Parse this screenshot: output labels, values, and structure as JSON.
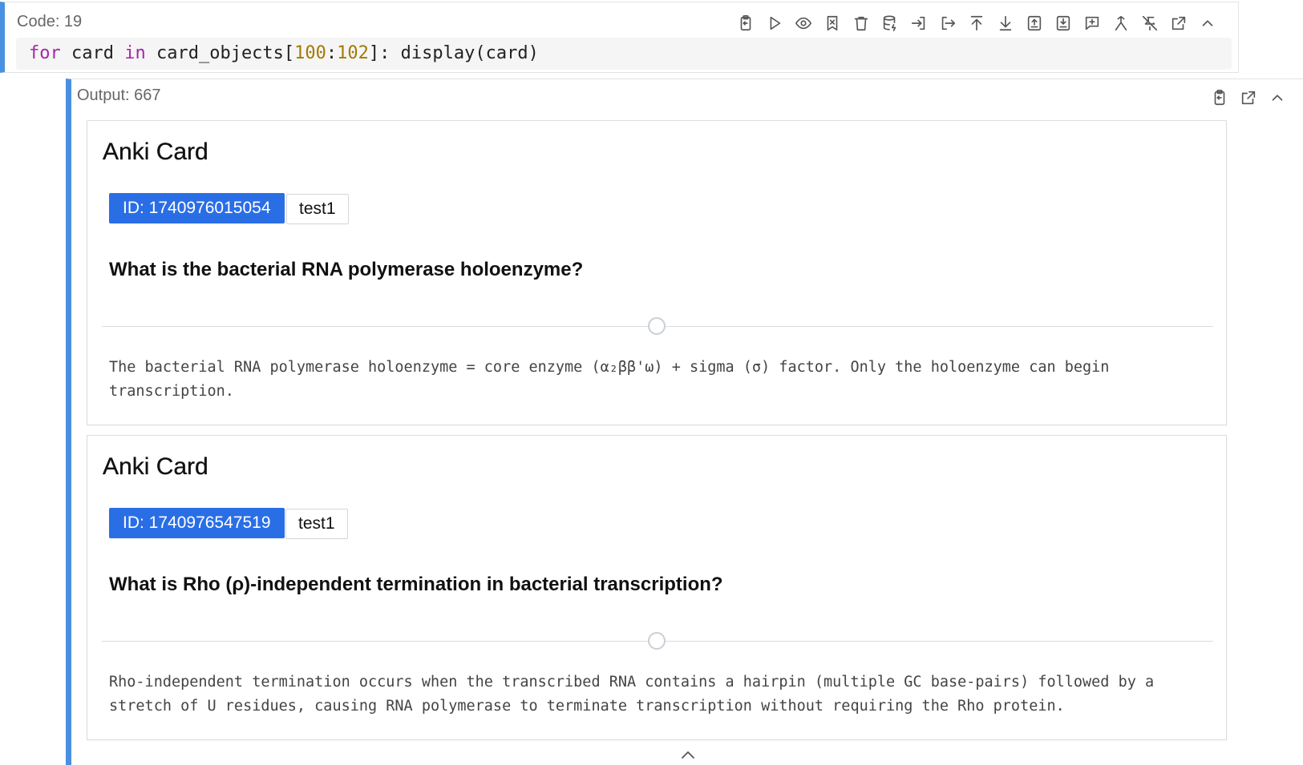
{
  "code_cell": {
    "label": "Code: 19",
    "code": {
      "kw_for": "for",
      "t1": " card ",
      "kw_in": "in",
      "t2": " card_objects[",
      "n1": "100",
      "t3": ":",
      "n2": "102",
      "t4": "]: display(card)"
    },
    "toolbar_icons": [
      "copy-icon",
      "run-icon",
      "eye-icon",
      "bookmark-x-icon",
      "trash-icon",
      "database-icon",
      "login-icon",
      "logout-icon",
      "arrow-up-to-line-icon",
      "arrow-down-to-line-icon",
      "file-up-icon",
      "file-down-icon",
      "message-plus-icon",
      "merge-icon",
      "pin-off-icon",
      "external-link-icon",
      "chevron-up-icon"
    ]
  },
  "output": {
    "label": "Output: 667",
    "toolbar_icons": [
      "copy-icon",
      "external-link-icon",
      "chevron-up-icon"
    ],
    "cards": [
      {
        "title": "Anki Card",
        "id_badge": "ID: 1740976015054",
        "tag": "test1",
        "question": "What is the bacterial RNA polymerase holoenzyme?",
        "answer": "The bacterial RNA polymerase holoenzyme = core enzyme (α₂ββ'ω) + sigma (σ) factor. Only the holoenzyme can begin transcription."
      },
      {
        "title": "Anki Card",
        "id_badge": "ID: 1740976547519",
        "tag": "test1",
        "question": "What is Rho (ρ)-independent termination in bacterial transcription?",
        "answer": "Rho-independent termination occurs when the transcribed RNA contains a hairpin (multiple GC base-pairs) followed by a stretch of U residues, causing RNA polymerase to terminate transcription without requiring the Rho protein."
      }
    ]
  },
  "colors": {
    "accent": "#4a90e2",
    "badge": "#2a6ee6",
    "keyword": "#a626a4",
    "number": "#a37a00"
  }
}
